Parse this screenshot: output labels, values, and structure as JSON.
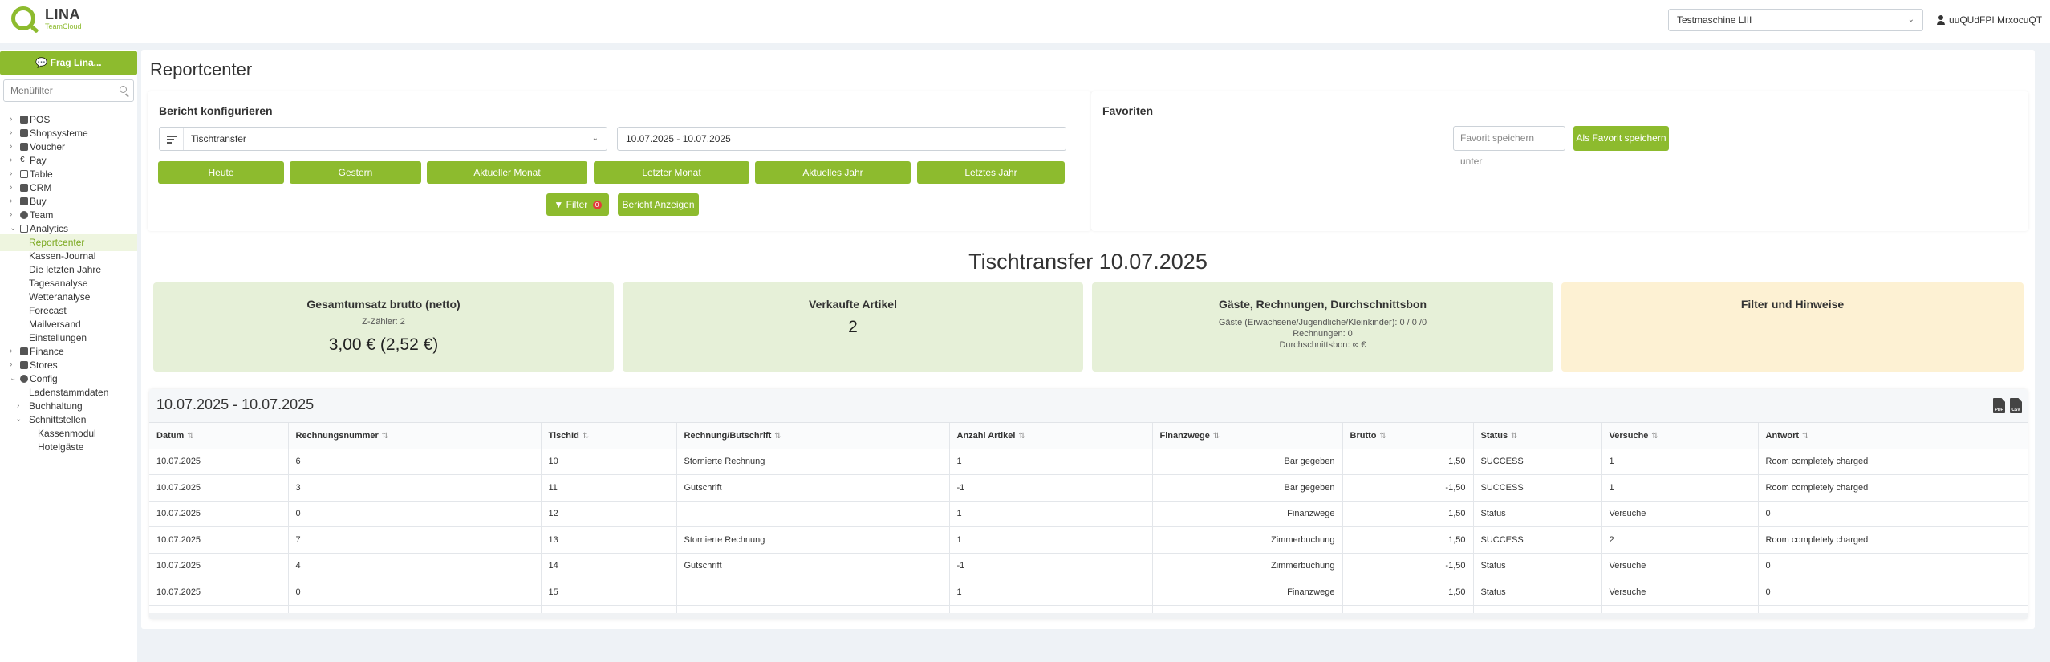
{
  "topbar": {
    "logo_main": "LINA",
    "logo_sub": "TeamCloud",
    "machine_select_value": "Testmaschine LIII",
    "user_name": "uuQUdFPI MrxocuQT"
  },
  "sidebar": {
    "ask_button": "Frag Lina...",
    "filter_placeholder": "Menüfilter",
    "items": [
      {
        "label": "POS"
      },
      {
        "label": "Shopsysteme"
      },
      {
        "label": "Voucher"
      },
      {
        "label": "Pay"
      },
      {
        "label": "Table"
      },
      {
        "label": "CRM"
      },
      {
        "label": "Buy"
      },
      {
        "label": "Team"
      },
      {
        "label": "Analytics"
      },
      {
        "label": "Reportcenter"
      },
      {
        "label": "Kassen-Journal"
      },
      {
        "label": "Die letzten Jahre"
      },
      {
        "label": "Tagesanalyse"
      },
      {
        "label": "Wetteranalyse"
      },
      {
        "label": "Forecast"
      },
      {
        "label": "Mailversand"
      },
      {
        "label": "Einstellungen"
      },
      {
        "label": "Finance"
      },
      {
        "label": "Stores"
      },
      {
        "label": "Config"
      },
      {
        "label": "Ladenstammdaten"
      },
      {
        "label": "Buchhaltung"
      },
      {
        "label": "Schnittstellen"
      },
      {
        "label": "Kassenmodul"
      },
      {
        "label": "Hotelgäste"
      }
    ]
  },
  "main": {
    "page_title": "Reportcenter",
    "config": {
      "title": "Bericht konfigurieren",
      "report_type": "Tischtransfer",
      "date_range": "10.07.2025 - 10.07.2025",
      "period_buttons": [
        "Heute",
        "Gestern",
        "Aktueller Monat",
        "Letzter Monat",
        "Aktuelles Jahr",
        "Letztes Jahr"
      ],
      "filter_button": "Filter",
      "filter_count": "0",
      "show_report_button": "Bericht Anzeigen"
    },
    "favorites": {
      "title": "Favoriten",
      "name_placeholder": "Favorit speichern unter",
      "save_button": "Als Favorit speichern"
    },
    "report_heading": "Tischtransfer 10.07.2025",
    "kpis": {
      "revenue_title": "Gesamtumsatz brutto (netto)",
      "revenue_sub": "Z-Zähler: 2",
      "revenue_value": "3,00 € (2,52 €)",
      "sold_title": "Verkaufte Artikel",
      "sold_value": "2",
      "guests_title": "Gäste, Rechnungen, Durchschnittsbon",
      "guests_line1": "Gäste (Erwachsene/Jugendliche/Kleinkinder): 0 / 0 /0",
      "guests_line2": "Rechnungen: 0",
      "guests_line3": "Durchschnittsbon: ∞ €",
      "filter_title": "Filter und Hinweise"
    },
    "table": {
      "range": "10.07.2025 - 10.07.2025",
      "export_pdf": "PDF",
      "export_csv": "CSV",
      "columns": [
        "Datum",
        "Rechnungsnummer",
        "TischId",
        "Rechnung/Butschrift",
        "Anzahl Artikel",
        "Finanzwege",
        "Brutto",
        "Status",
        "Versuche",
        "Antwort"
      ],
      "rows": [
        [
          "10.07.2025",
          "6",
          "10",
          "Stornierte Rechnung",
          "1",
          "Bar gegeben",
          "1,50",
          "SUCCESS",
          "1",
          "Room completely charged"
        ],
        [
          "10.07.2025",
          "3",
          "11",
          "Gutschrift",
          "-1",
          "Bar gegeben",
          "-1,50",
          "SUCCESS",
          "1",
          "Room completely charged"
        ],
        [
          "10.07.2025",
          "0",
          "12",
          "",
          "1",
          "Finanzwege",
          "1,50",
          "Status",
          "Versuche",
          "0"
        ],
        [
          "10.07.2025",
          "7",
          "13",
          "Stornierte Rechnung",
          "1",
          "Zimmerbuchung",
          "1,50",
          "SUCCESS",
          "2",
          "Room completely charged"
        ],
        [
          "10.07.2025",
          "4",
          "14",
          "Gutschrift",
          "-1",
          "Zimmerbuchung",
          "-1,50",
          "Status",
          "Versuche",
          "0"
        ],
        [
          "10.07.2025",
          "0",
          "15",
          "",
          "1",
          "Finanzwege",
          "1,50",
          "Status",
          "Versuche",
          "0"
        ]
      ]
    }
  },
  "colors": {
    "accent": "#8dbb2e",
    "kpi_green": "#e6f0d8",
    "kpi_yellow": "#fdf1d3",
    "badge_red": "#e23b3b"
  }
}
